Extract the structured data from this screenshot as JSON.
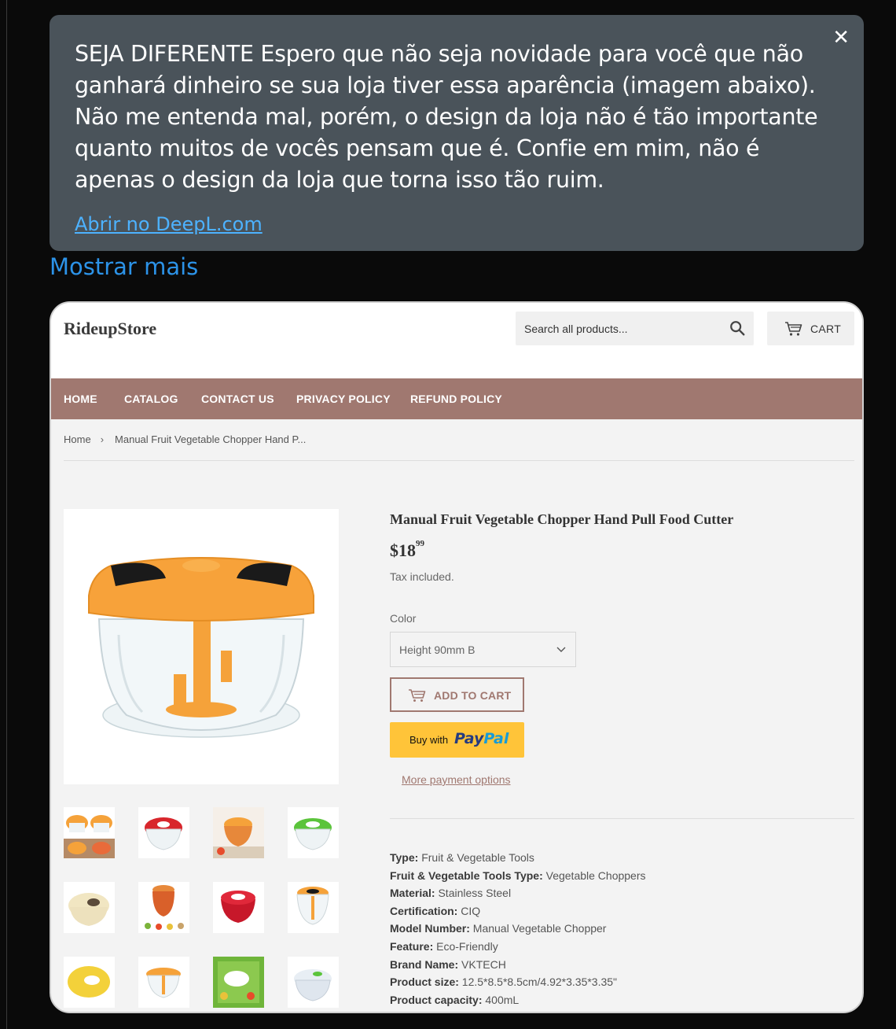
{
  "popup": {
    "text": "SEJA DIFERENTE Espero que não seja novidade para você que não ganhará dinheiro se sua loja tiver essa aparência (imagem abaixo). Não me entenda mal, porém, o design da loja não é tão importante quanto muitos de vocês pensam que é. Confie em mim, não é apenas o design da loja que torna isso tão ruim.",
    "link": "Abrir no DeepL.com",
    "close": "✕"
  },
  "show_more": "Mostrar mais",
  "store": {
    "logo": "RideupStore",
    "search_placeholder": "Search all products...",
    "cart_label": "CART",
    "nav": [
      "HOME",
      "CATALOG",
      "CONTACT US",
      "PRIVACY POLICY",
      "REFUND POLICY"
    ],
    "breadcrumb": {
      "home": "Home",
      "sep": "›",
      "current": "Manual Fruit Vegetable Chopper Hand P..."
    }
  },
  "product": {
    "title": "Manual Fruit Vegetable Chopper Hand Pull Food Cutter",
    "price_main": "$18",
    "price_cents": "99",
    "tax": "Tax included.",
    "color_label": "Color",
    "color_value": "Height 90mm B",
    "add_to_cart": "ADD TO CART",
    "paypal_buy": "Buy with",
    "paypal_pay": "Pay",
    "paypal_pal": "Pal",
    "more_payment": "More payment options",
    "specs": [
      {
        "k": "Type:",
        "v": " Fruit & Vegetable Tools"
      },
      {
        "k": "Fruit & Vegetable Tools Type:",
        "v": " Vegetable Choppers"
      },
      {
        "k": "Material:",
        "v": " Stainless Steel"
      },
      {
        "k": "Certification:",
        "v": " CIQ"
      },
      {
        "k": "Model Number:",
        "v": " Manual Vegetable Chopper"
      },
      {
        "k": "Feature:",
        "v": " Eco-Friendly"
      },
      {
        "k": "Brand Name:",
        "v": " VKTECH"
      },
      {
        "k": "Product size:",
        "v": " 12.5*8.5*8.5cm/4.92*3.35*3.35\""
      },
      {
        "k": "Product capacity:",
        "v": " 400mL"
      }
    ]
  },
  "colors": {
    "nav_bg": "#a07870",
    "accent": "#a07870",
    "paypal_bg": "#ffc439",
    "popup_bg": "#4a535a",
    "link_blue": "#4db2ff"
  }
}
